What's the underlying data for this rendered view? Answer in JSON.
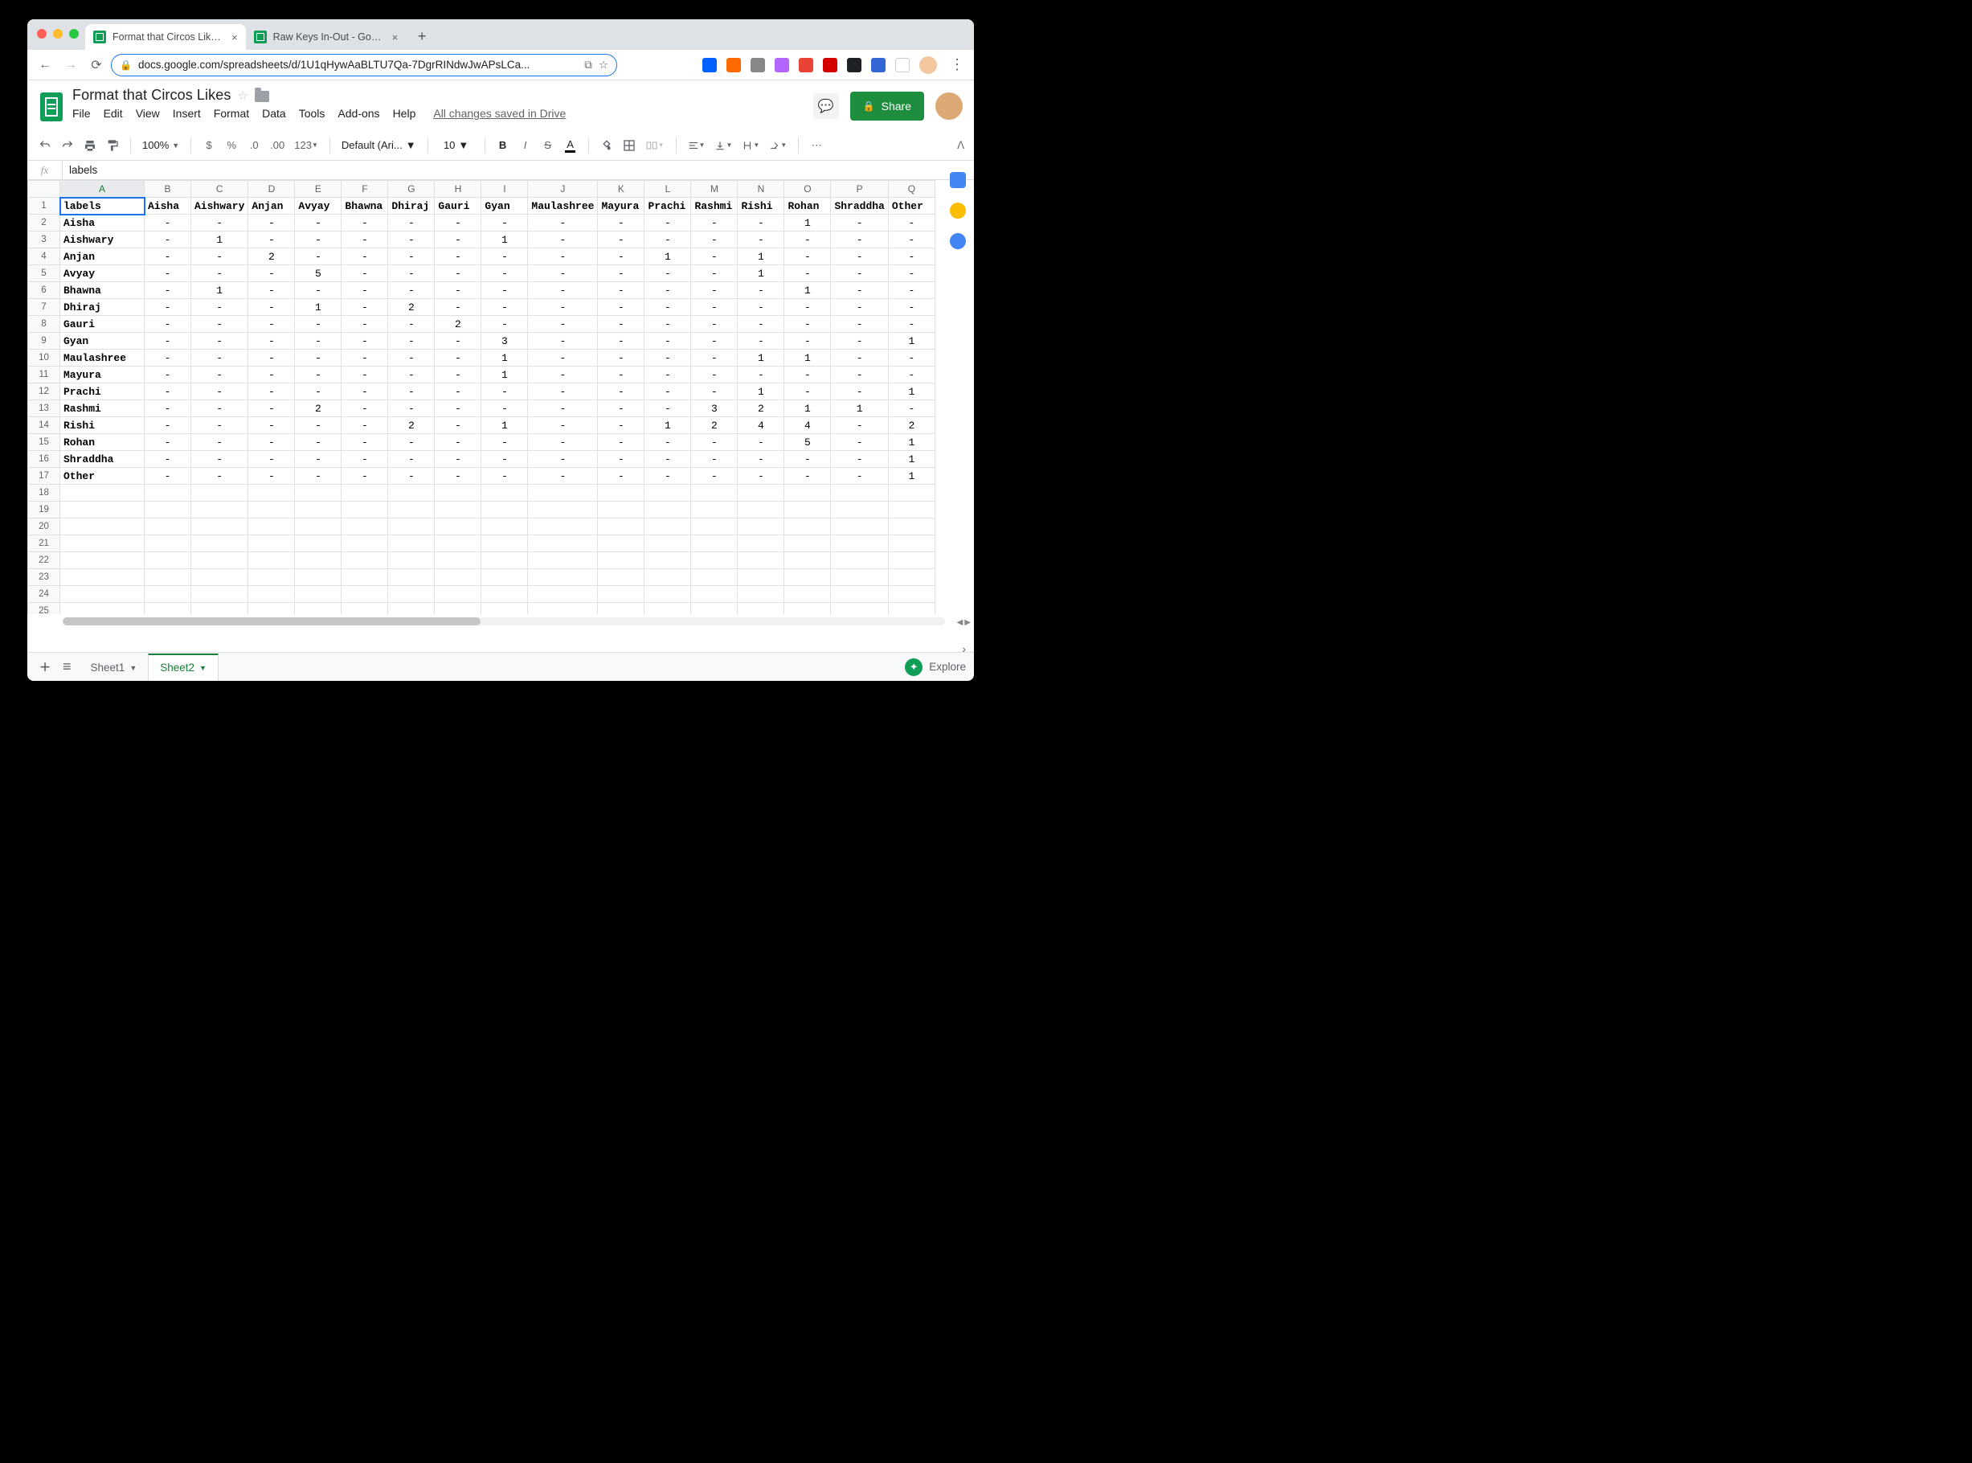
{
  "browser": {
    "tabs": [
      {
        "title": "Format that Circos Likes - Goo",
        "active": true
      },
      {
        "title": "Raw Keys In-Out - Google Shee",
        "active": false
      }
    ],
    "url": "docs.google.com/spreadsheets/d/1U1qHywAaBLTU7Qa-7DgrRINdwJwAPsLCa..."
  },
  "doc": {
    "title": "Format that Circos Likes",
    "menus": [
      "File",
      "Edit",
      "View",
      "Insert",
      "Format",
      "Data",
      "Tools",
      "Add-ons",
      "Help"
    ],
    "save_status": "All changes saved in Drive",
    "share_label": "Share",
    "zoom": "100%",
    "font_name": "Default (Ari...",
    "font_size": "10",
    "formula_value": "labels",
    "explore_label": "Explore"
  },
  "sheet": {
    "tabs": [
      {
        "name": "Sheet1",
        "active": false
      },
      {
        "name": "Sheet2",
        "active": true
      }
    ],
    "col_letters": [
      "A",
      "B",
      "C",
      "D",
      "E",
      "F",
      "G",
      "H",
      "I",
      "J",
      "K",
      "L",
      "M",
      "N",
      "O",
      "P",
      "Q"
    ],
    "col_headers": [
      "labels",
      "Aisha",
      "Aishwary",
      "Anjan",
      "Avyay",
      "Bhawna",
      "Dhiraj",
      "Gauri",
      "Gyan",
      "Maulashree",
      "Mayura",
      "Prachi",
      "Rashmi",
      "Rishi",
      "Rohan",
      "Shraddha",
      "Other"
    ],
    "rows": [
      {
        "n": 2,
        "label": "Aisha",
        "cells": [
          "-",
          "-",
          "-",
          "-",
          "-",
          "-",
          "-",
          "-",
          "-",
          "-",
          "-",
          "-",
          "-",
          "1",
          "-",
          "-"
        ]
      },
      {
        "n": 3,
        "label": "Aishwary",
        "cells": [
          "-",
          "1",
          "-",
          "-",
          "-",
          "-",
          "-",
          "1",
          "-",
          "-",
          "-",
          "-",
          "-",
          "-",
          "-",
          "-"
        ]
      },
      {
        "n": 4,
        "label": "Anjan",
        "cells": [
          "-",
          "-",
          "2",
          "-",
          "-",
          "-",
          "-",
          "-",
          "-",
          "-",
          "1",
          "-",
          "1",
          "-",
          "-",
          "-"
        ]
      },
      {
        "n": 5,
        "label": "Avyay",
        "cells": [
          "-",
          "-",
          "-",
          "5",
          "-",
          "-",
          "-",
          "-",
          "-",
          "-",
          "-",
          "-",
          "1",
          "-",
          "-",
          "-"
        ]
      },
      {
        "n": 6,
        "label": "Bhawna",
        "cells": [
          "-",
          "1",
          "-",
          "-",
          "-",
          "-",
          "-",
          "-",
          "-",
          "-",
          "-",
          "-",
          "-",
          "1",
          "-",
          "-"
        ]
      },
      {
        "n": 7,
        "label": "Dhiraj",
        "cells": [
          "-",
          "-",
          "-",
          "1",
          "-",
          "2",
          "-",
          "-",
          "-",
          "-",
          "-",
          "-",
          "-",
          "-",
          "-",
          "-"
        ]
      },
      {
        "n": 8,
        "label": "Gauri",
        "cells": [
          "-",
          "-",
          "-",
          "-",
          "-",
          "-",
          "2",
          "-",
          "-",
          "-",
          "-",
          "-",
          "-",
          "-",
          "-",
          "-"
        ]
      },
      {
        "n": 9,
        "label": "Gyan",
        "cells": [
          "-",
          "-",
          "-",
          "-",
          "-",
          "-",
          "-",
          "3",
          "-",
          "-",
          "-",
          "-",
          "-",
          "-",
          "-",
          "1"
        ]
      },
      {
        "n": 10,
        "label": "Maulashree",
        "cells": [
          "-",
          "-",
          "-",
          "-",
          "-",
          "-",
          "-",
          "1",
          "-",
          "-",
          "-",
          "-",
          "1",
          "1",
          "-",
          "-"
        ]
      },
      {
        "n": 11,
        "label": "Mayura",
        "cells": [
          "-",
          "-",
          "-",
          "-",
          "-",
          "-",
          "-",
          "1",
          "-",
          "-",
          "-",
          "-",
          "-",
          "-",
          "-",
          "-"
        ]
      },
      {
        "n": 12,
        "label": "Prachi",
        "cells": [
          "-",
          "-",
          "-",
          "-",
          "-",
          "-",
          "-",
          "-",
          "-",
          "-",
          "-",
          "-",
          "1",
          "-",
          "-",
          "1"
        ]
      },
      {
        "n": 13,
        "label": "Rashmi",
        "cells": [
          "-",
          "-",
          "-",
          "2",
          "-",
          "-",
          "-",
          "-",
          "-",
          "-",
          "-",
          "3",
          "2",
          "1",
          "1",
          "-"
        ]
      },
      {
        "n": 14,
        "label": "Rishi",
        "cells": [
          "-",
          "-",
          "-",
          "-",
          "-",
          "2",
          "-",
          "1",
          "-",
          "-",
          "1",
          "2",
          "4",
          "4",
          "-",
          "2"
        ]
      },
      {
        "n": 15,
        "label": "Rohan",
        "cells": [
          "-",
          "-",
          "-",
          "-",
          "-",
          "-",
          "-",
          "-",
          "-",
          "-",
          "-",
          "-",
          "-",
          "5",
          "-",
          "1"
        ]
      },
      {
        "n": 16,
        "label": "Shraddha",
        "cells": [
          "-",
          "-",
          "-",
          "-",
          "-",
          "-",
          "-",
          "-",
          "-",
          "-",
          "-",
          "-",
          "-",
          "-",
          "-",
          "1"
        ]
      },
      {
        "n": 17,
        "label": "Other",
        "cells": [
          "-",
          "-",
          "-",
          "-",
          "-",
          "-",
          "-",
          "-",
          "-",
          "-",
          "-",
          "-",
          "-",
          "-",
          "-",
          "1"
        ]
      }
    ],
    "empty_rows": [
      18,
      19,
      20,
      21,
      22,
      23,
      24,
      25
    ]
  },
  "chart_data": {
    "type": "table",
    "title": "Format that Circos Likes",
    "row_labels": [
      "Aisha",
      "Aishwary",
      "Anjan",
      "Avyay",
      "Bhawna",
      "Dhiraj",
      "Gauri",
      "Gyan",
      "Maulashree",
      "Mayura",
      "Prachi",
      "Rashmi",
      "Rishi",
      "Rohan",
      "Shraddha",
      "Other"
    ],
    "col_labels": [
      "Aisha",
      "Aishwary",
      "Anjan",
      "Avyay",
      "Bhawna",
      "Dhiraj",
      "Gauri",
      "Gyan",
      "Maulashree",
      "Mayura",
      "Prachi",
      "Rashmi",
      "Rishi",
      "Rohan",
      "Shraddha",
      "Other"
    ],
    "matrix": [
      [
        null,
        null,
        null,
        null,
        null,
        null,
        null,
        null,
        null,
        null,
        null,
        null,
        null,
        1,
        null,
        null
      ],
      [
        null,
        1,
        null,
        null,
        null,
        null,
        null,
        1,
        null,
        null,
        null,
        null,
        null,
        null,
        null,
        null
      ],
      [
        null,
        null,
        2,
        null,
        null,
        null,
        null,
        null,
        null,
        null,
        1,
        null,
        1,
        null,
        null,
        null
      ],
      [
        null,
        null,
        null,
        5,
        null,
        null,
        null,
        null,
        null,
        null,
        null,
        null,
        1,
        null,
        null,
        null
      ],
      [
        null,
        1,
        null,
        null,
        null,
        null,
        null,
        null,
        null,
        null,
        null,
        null,
        null,
        1,
        null,
        null
      ],
      [
        null,
        null,
        null,
        1,
        null,
        2,
        null,
        null,
        null,
        null,
        null,
        null,
        null,
        null,
        null,
        null
      ],
      [
        null,
        null,
        null,
        null,
        null,
        null,
        2,
        null,
        null,
        null,
        null,
        null,
        null,
        null,
        null,
        null
      ],
      [
        null,
        null,
        null,
        null,
        null,
        null,
        null,
        3,
        null,
        null,
        null,
        null,
        null,
        null,
        null,
        1
      ],
      [
        null,
        null,
        null,
        null,
        null,
        null,
        null,
        1,
        null,
        null,
        null,
        null,
        1,
        1,
        null,
        null
      ],
      [
        null,
        null,
        null,
        null,
        null,
        null,
        null,
        1,
        null,
        null,
        null,
        null,
        null,
        null,
        null,
        null
      ],
      [
        null,
        null,
        null,
        null,
        null,
        null,
        null,
        null,
        null,
        null,
        null,
        null,
        1,
        null,
        null,
        1
      ],
      [
        null,
        null,
        null,
        2,
        null,
        null,
        null,
        null,
        null,
        null,
        null,
        3,
        2,
        1,
        1,
        null
      ],
      [
        null,
        null,
        null,
        null,
        null,
        2,
        null,
        1,
        null,
        null,
        1,
        2,
        4,
        4,
        null,
        2
      ],
      [
        null,
        null,
        null,
        null,
        null,
        null,
        null,
        null,
        null,
        null,
        null,
        null,
        null,
        5,
        null,
        1
      ],
      [
        null,
        null,
        null,
        null,
        null,
        null,
        null,
        null,
        null,
        null,
        null,
        null,
        null,
        null,
        null,
        1
      ],
      [
        null,
        null,
        null,
        null,
        null,
        null,
        null,
        null,
        null,
        null,
        null,
        null,
        null,
        null,
        null,
        1
      ]
    ]
  }
}
